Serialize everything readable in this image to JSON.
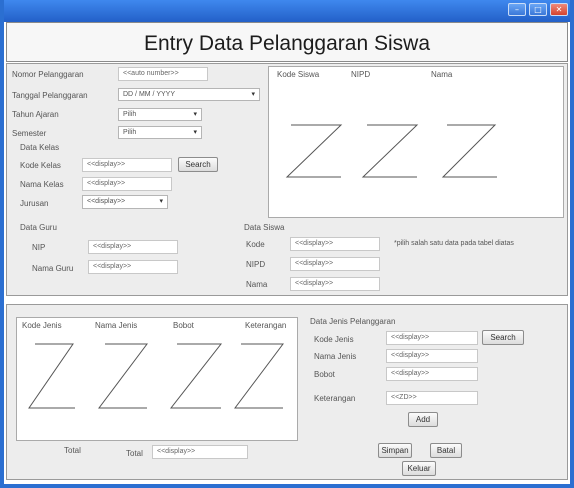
{
  "window": {
    "minimize_glyph": "–",
    "maximize_glyph": "□",
    "close_glyph": "✕"
  },
  "header": {
    "title": "Entry Data Pelanggaran Siswa"
  },
  "form": {
    "nomor_label": "Nomor Pelanggaran",
    "nomor_value": "<<auto number>>",
    "tanggal_label": "Tanggal Pelanggaran",
    "tanggal_value": "DD / MM / YYYY",
    "tahun_label": "Tahun Ajaran",
    "tahun_value": "Pilih",
    "semester_label": "Semester",
    "semester_value": "Pilih"
  },
  "kelas": {
    "title": "Data Kelas",
    "kode_label": "Kode Kelas",
    "kode_value": "<<display>>",
    "search_label": "Search",
    "nama_label": "Nama Kelas",
    "nama_value": "<<display>>",
    "jurusan_label": "Jurusan",
    "jurusan_value": "<<display>>"
  },
  "guru": {
    "title": "Data Guru",
    "nip_label": "NIP",
    "nip_value": "<<display>>",
    "nama_label": "Nama Guru",
    "nama_value": "<<display>>"
  },
  "siswa_table": {
    "columns": [
      "Kode Siswa",
      "NIPD",
      "Nama"
    ]
  },
  "siswa": {
    "title": "Data Siswa",
    "kode_label": "Kode",
    "kode_value": "<<display>>",
    "nipd_label": "NIPD",
    "nipd_value": "<<display>>",
    "nama_label": "Nama",
    "nama_value": "<<display>>",
    "note": "*pilih salah satu data pada tabel diatas"
  },
  "jenis_table": {
    "columns": [
      "Kode Jenis",
      "Nama Jenis",
      "Bobot",
      "Keterangan"
    ]
  },
  "totals": {
    "total_label_1": "Total",
    "total_label_2": "Total",
    "total_value": "<<display>>"
  },
  "jenis": {
    "title": "Data Jenis Pelanggaran",
    "kode_label": "Kode Jenis",
    "kode_value": "<<display>>",
    "search_label": "Search",
    "nama_label": "Nama Jenis",
    "nama_value": "<<display>>",
    "bobot_label": "Bobot",
    "bobot_value": "<<display>>",
    "keterangan_label": "Keterangan",
    "keterangan_value": "<<ZD>>",
    "add_label": "Add"
  },
  "actions": {
    "simpan": "Simpan",
    "batal": "Batal",
    "keluar": "Keluar"
  }
}
